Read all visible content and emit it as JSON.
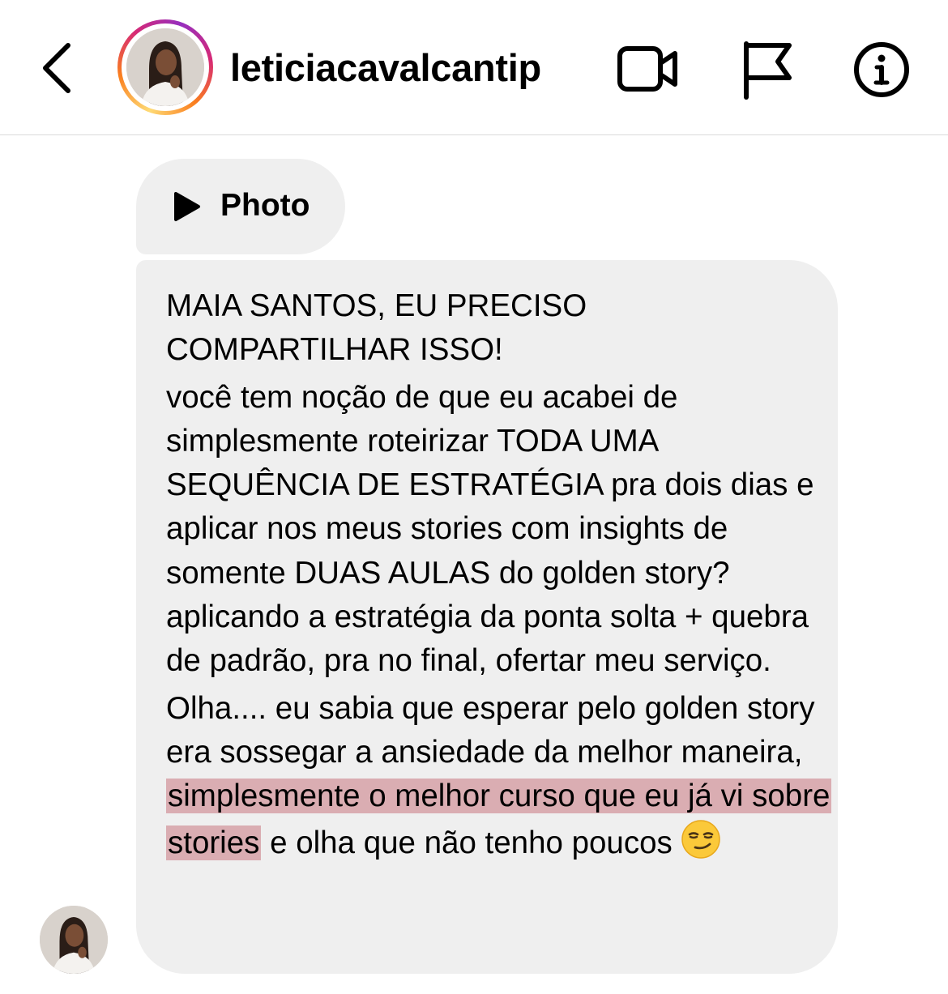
{
  "header": {
    "back_icon": "chevron-left-icon",
    "avatar_icon": "profile-avatar",
    "username": "leticiacavalcantip",
    "video_icon": "video-call-icon",
    "flag_icon": "flag-icon",
    "info_icon": "info-icon"
  },
  "thread": {
    "photo_message": {
      "icon": "play-icon",
      "label": "Photo"
    },
    "text_message": {
      "line_1": "MAIA SANTOS, EU PRECISO COMPARTILHAR ISSO!",
      "paragraph_2": "você tem noção de que eu acabei de simplesmente roteirizar TODA UMA SEQUÊNCIA DE ESTRATÉGIA pra dois dias e aplicar nos meus stories com insights de somente DUAS AULAS do golden story? aplicando a estratégia da ponta solta + quebra de padrão, pra no final, ofertar meu serviço.",
      "paragraph_3_start": "Olha.... eu sabia que esperar pelo golden story era sossegar a ansiedade da melhor maneira, ",
      "paragraph_3_highlight": "simplesmente o melhor curso que eu já vi sobre stories",
      "paragraph_3_end": " e olha que não tenho poucos ",
      "emoji": "smirking-face-emoji"
    },
    "sender_avatar": "sender-avatar"
  },
  "colors": {
    "bubble_bg": "#efefef",
    "highlight": "#cd848c",
    "divider": "#dbdbdb",
    "ring_gradient": [
      "#feda75",
      "#fa7e1e",
      "#d62976",
      "#962fbf"
    ]
  }
}
